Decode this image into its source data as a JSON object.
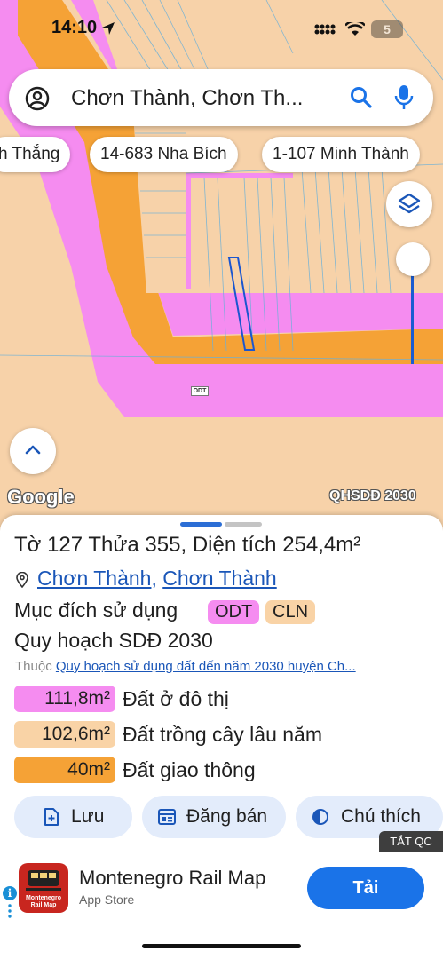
{
  "status_bar": {
    "time": "14:10",
    "battery": "5"
  },
  "search": {
    "text": "Chơn Thành, Chơn Th..."
  },
  "chips": [
    "h Thắng",
    "14-683 Nha Bích",
    "1-107 Minh Thành"
  ],
  "map": {
    "odt_label": "ODT",
    "google_logo": "Google",
    "layer_label": "QHSDĐ 2030"
  },
  "parcel": {
    "title": "Tờ 127 Thửa 355, Diện tích 254,4m²",
    "commune": "Chơn Thành",
    "district": "Chơn Thành",
    "purpose_label": "Mục đích sử dụng",
    "tags": [
      {
        "text": "ODT",
        "color": "#f58cf0"
      },
      {
        "text": "CLN",
        "color": "#f9d3a6"
      }
    ],
    "plan_title": "Quy hoạch SDĐ 2030",
    "belongs_prefix": "Thuộc",
    "belongs_link": "Quy hoạch sử dụng đất đến năm 2030 huyện Ch..."
  },
  "areas": [
    {
      "value": "111,8m²",
      "name": "Đất ở đô thị",
      "color": "#f58cf0"
    },
    {
      "value": "102,6m²",
      "name": "Đất trồng cây lâu năm",
      "color": "#f9d3a6"
    },
    {
      "value": "40m²",
      "name": "Đất giao thông",
      "color": "#f5a236"
    }
  ],
  "actions": {
    "save": "Lưu",
    "sell": "Đăng bán",
    "legend": "Chú thích"
  },
  "ad": {
    "close_label": "TẮT QC",
    "info_glyph": "i",
    "icon_line1": "Montenegro",
    "icon_line2": "Rail Map",
    "title": "Montenegro Rail Map",
    "subtitle": "App Store",
    "cta": "Tải"
  },
  "colors": {
    "accent": "#1a73e8",
    "pink_zone": "#f58cf0",
    "orange_road": "#f5a236",
    "land": "#f7d2a9"
  }
}
